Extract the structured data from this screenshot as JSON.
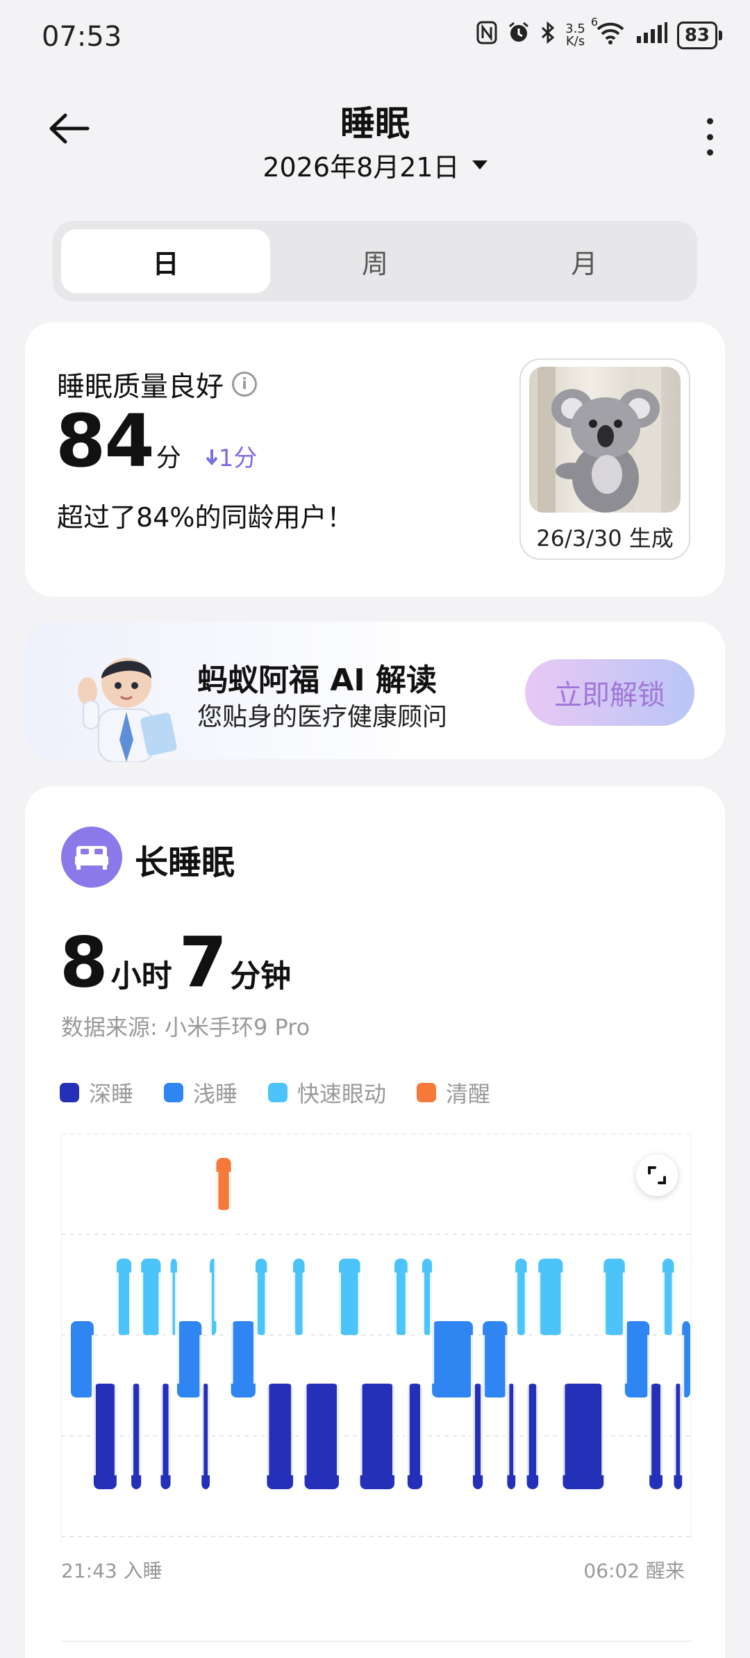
{
  "status_bar": {
    "time": "07:53",
    "net_speed_value": "3.5",
    "net_speed_unit": "K/s",
    "wifi_badge": "6",
    "battery": "83"
  },
  "header": {
    "title": "睡眠",
    "date": "2026年8月21日"
  },
  "tabs": [
    {
      "label": "日",
      "active": true
    },
    {
      "label": "周",
      "active": false
    },
    {
      "label": "月",
      "active": false
    }
  ],
  "quality": {
    "label": "睡眠质量良好",
    "score": "84",
    "unit": "分",
    "delta": "1分",
    "description": "超过了84%的同龄用户！",
    "image_date": "26/3/30 生成"
  },
  "ai_promo": {
    "title": "蚂蚁阿福 AI 解读",
    "subtitle": "您贴身的医疗健康顾问",
    "button": "立即解锁"
  },
  "sleep": {
    "title": "长睡眠",
    "hours": "8",
    "hours_unit": "小时",
    "minutes": "7",
    "minutes_unit": "分钟",
    "source": "数据来源: 小米手环9 Pro",
    "start": "21:43 入睡",
    "end": "06:02 醒来"
  },
  "colors": {
    "deep": "#2530b8",
    "light": "#2f86f2",
    "rem": "#4cc4fa",
    "awake": "#f5793a",
    "accent": "#8c79e9"
  },
  "chart_data": {
    "type": "hypnogram",
    "legend": [
      "深睡",
      "浅睡",
      "快速眼动",
      "清醒"
    ],
    "start_time": "21:43",
    "end_time": "06:02",
    "segments": [
      {
        "stage": "浅睡",
        "duration": 14
      },
      {
        "stage": "深睡",
        "duration": 14
      },
      {
        "stage": "快速眼动",
        "duration": 9
      },
      {
        "stage": "深睡",
        "duration": 6
      },
      {
        "stage": "快速眼动",
        "duration": 12
      },
      {
        "stage": "深睡",
        "duration": 6
      },
      {
        "stage": "快速眼动",
        "duration": 4
      },
      {
        "stage": "浅睡",
        "duration": 15
      },
      {
        "stage": "深睡",
        "duration": 5
      },
      {
        "stage": "快速眼动",
        "duration": 4
      },
      {
        "stage": "清醒",
        "duration": 9
      },
      {
        "stage": "浅睡",
        "duration": 15
      },
      {
        "stage": "快速眼动",
        "duration": 7
      },
      {
        "stage": "深睡",
        "duration": 16
      },
      {
        "stage": "快速眼动",
        "duration": 7
      },
      {
        "stage": "深睡",
        "duration": 21
      },
      {
        "stage": "快速眼动",
        "duration": 13
      },
      {
        "stage": "深睡",
        "duration": 21
      },
      {
        "stage": "快速眼动",
        "duration": 8
      },
      {
        "stage": "深睡",
        "duration": 9
      },
      {
        "stage": "快速眼动",
        "duration": 6
      },
      {
        "stage": "浅睡",
        "duration": 25
      },
      {
        "stage": "深睡",
        "duration": 6
      },
      {
        "stage": "浅睡",
        "duration": 15
      },
      {
        "stage": "深睡",
        "duration": 5
      },
      {
        "stage": "快速眼动",
        "duration": 7
      },
      {
        "stage": "深睡",
        "duration": 7
      },
      {
        "stage": "快速眼动",
        "duration": 15
      },
      {
        "stage": "深睡",
        "duration": 25
      },
      {
        "stage": "快速眼动",
        "duration": 13
      },
      {
        "stage": "浅睡",
        "duration": 15
      },
      {
        "stage": "深睡",
        "duration": 8
      },
      {
        "stage": "快速眼动",
        "duration": 7
      },
      {
        "stage": "深睡",
        "duration": 5
      },
      {
        "stage": "浅睡",
        "duration": 5
      }
    ]
  }
}
